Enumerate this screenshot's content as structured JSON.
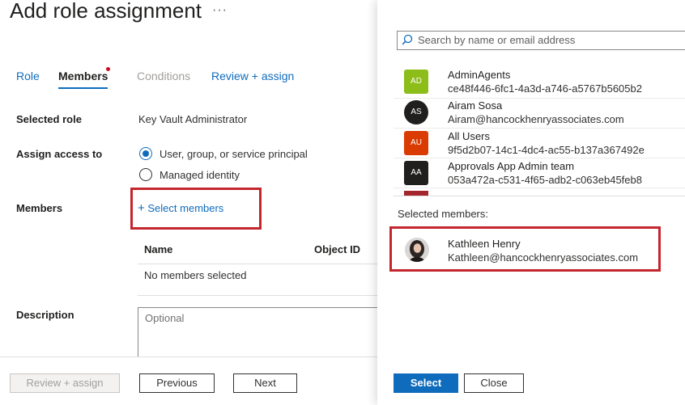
{
  "header": {
    "title": "Add role assignment",
    "more": "···"
  },
  "tabs": [
    {
      "label": "Role"
    },
    {
      "label": "Members"
    },
    {
      "label": "Conditions"
    },
    {
      "label": "Review + assign"
    }
  ],
  "form": {
    "selected_role_label": "Selected role",
    "selected_role_value": "Key Vault Administrator",
    "assign_access_label": "Assign access to",
    "option_user": "User, group, or service principal",
    "option_managed": "Managed identity",
    "members_label": "Members",
    "select_members_plus": "+",
    "select_members_text": "Select members",
    "table": {
      "col_name": "Name",
      "col_object_id": "Object ID",
      "empty": "No members selected"
    },
    "description_label": "Description",
    "description_placeholder": "Optional"
  },
  "footer": {
    "review_assign": "Review + assign",
    "previous": "Previous",
    "next": "Next"
  },
  "panel": {
    "search_placeholder": "Search by name or email address",
    "items": [
      {
        "initials": "AD",
        "name": "AdminAgents",
        "sub": "ce48f446-6fc1-4a3d-a746-a5767b5605b2",
        "color": "#8cbd18"
      },
      {
        "initials": "AS",
        "name": "Airam Sosa",
        "sub": "Airam@hancockhenryassociates.com",
        "color": "#201f1e"
      },
      {
        "initials": "AU",
        "name": "All Users",
        "sub": "9f5d2b07-14c1-4dc4-ac55-b137a367492e",
        "color": "#da3b01"
      },
      {
        "initials": "AA",
        "name": "Approvals App Admin team",
        "sub": "053a472a-c531-4f65-adb2-c063eb45feb8",
        "color": "#201f1e"
      }
    ],
    "selected_label": "Selected members:",
    "selected": {
      "name": "Kathleen Henry",
      "email": "Kathleen@hancockhenryassociates.com"
    },
    "select_button": "Select",
    "close_button": "Close"
  },
  "colors": {
    "accent": "#0f6cbd",
    "highlight": "#c4262e"
  }
}
